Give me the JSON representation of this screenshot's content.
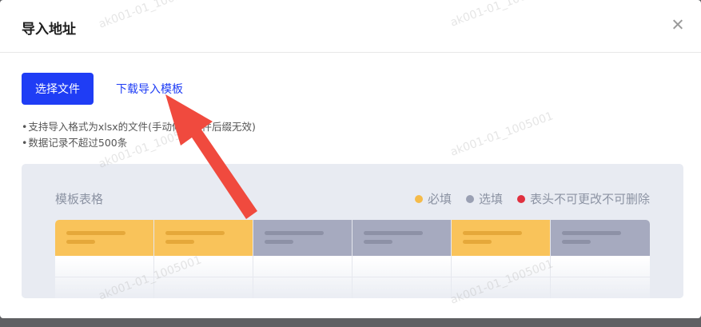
{
  "dialog": {
    "title": "导入地址",
    "select_button": "选择文件",
    "download_link": "下载导入模板",
    "hints": [
      "支持导入格式为xlsx的文件(手动修改文件后缀无效)",
      "数据记录不超过500条"
    ]
  },
  "preview": {
    "title": "模板表格",
    "legend": [
      {
        "label": "必填",
        "color": "#f5bb4a"
      },
      {
        "label": "选填",
        "color": "#9aa0b3"
      },
      {
        "label": "表头不可更改不可删除",
        "color": "#e0303f"
      }
    ],
    "columns": [
      {
        "type": "required",
        "fill": "#f9c35a",
        "bar": "#e5a83a"
      },
      {
        "type": "required",
        "fill": "#f9c35a",
        "bar": "#e5a83a"
      },
      {
        "type": "optional",
        "fill": "#a6aabf",
        "bar": "#8d91a6"
      },
      {
        "type": "optional",
        "fill": "#a6aabf",
        "bar": "#8d91a6"
      },
      {
        "type": "required",
        "fill": "#f9c35a",
        "bar": "#e5a83a"
      },
      {
        "type": "optional",
        "fill": "#a6aabf",
        "bar": "#8d91a6"
      }
    ]
  },
  "watermark": "ak001-01_1005001",
  "colors": {
    "primary": "#1f3df5",
    "annotation_arrow": "#f04a3e"
  }
}
